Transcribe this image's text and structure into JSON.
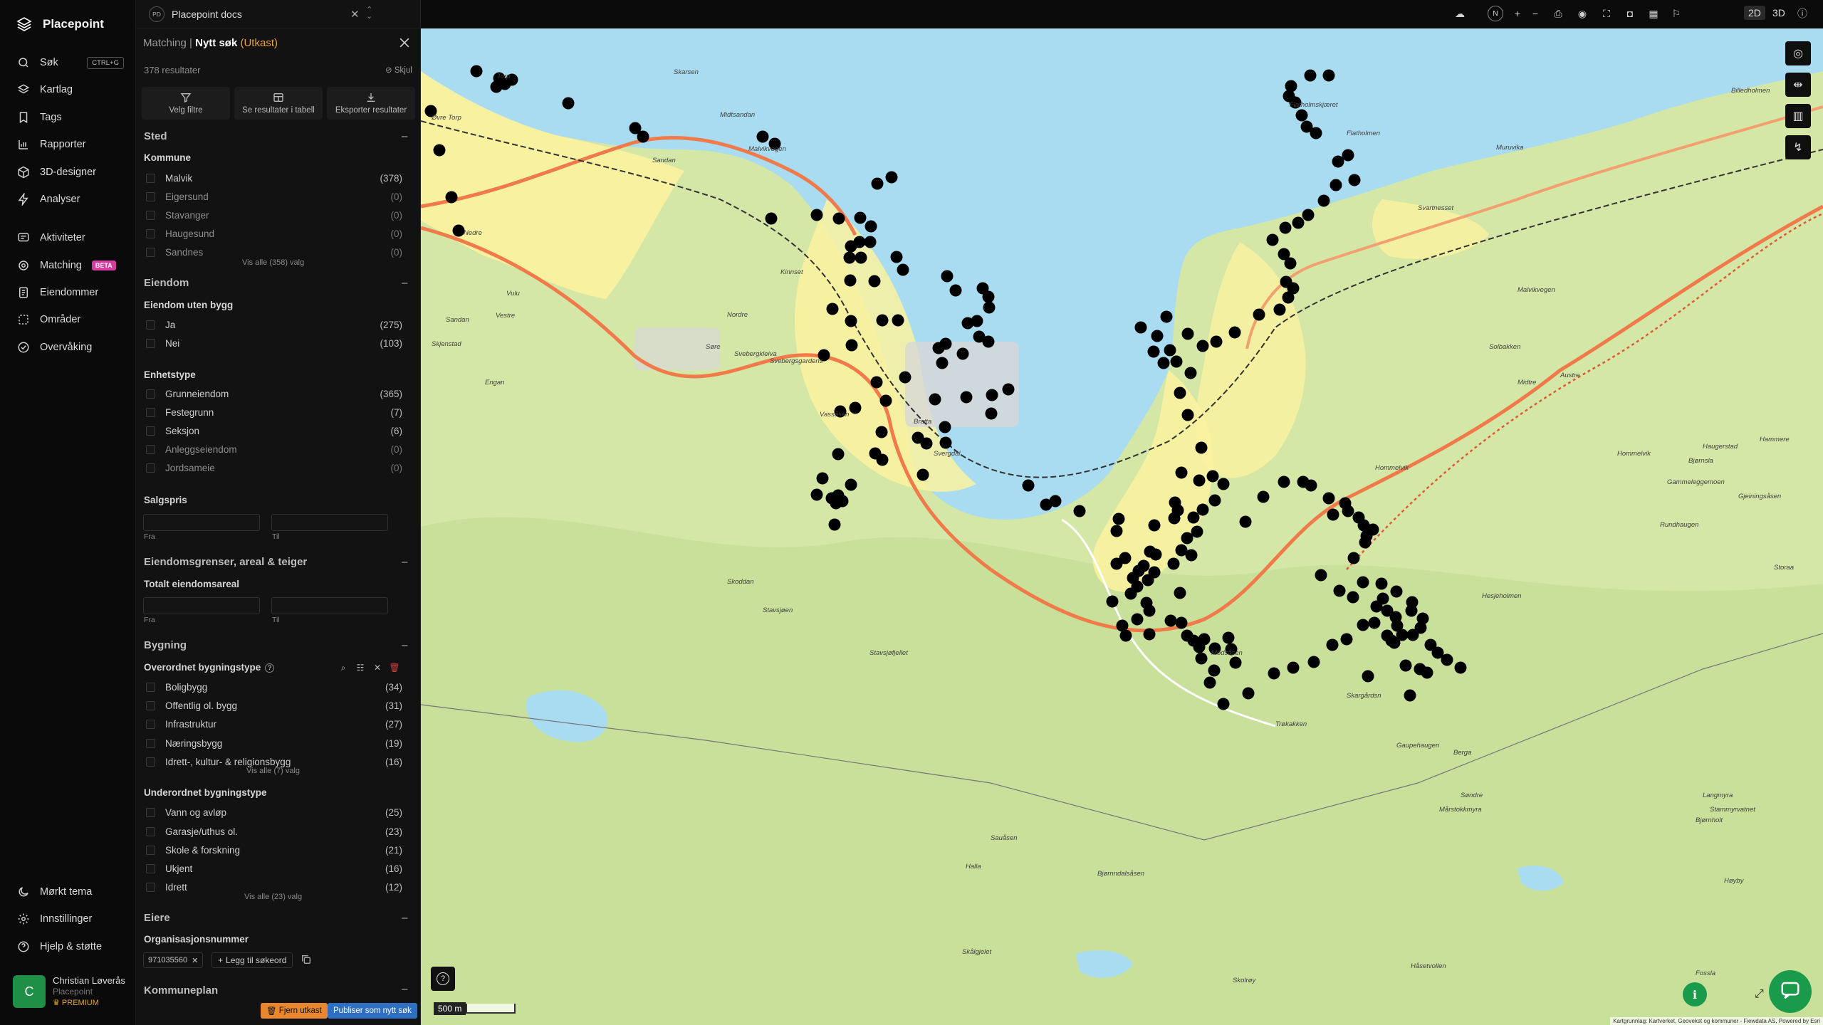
{
  "app": {
    "name": "Placepoint"
  },
  "nav": {
    "items": [
      {
        "label": "Søk",
        "shortcut": "CTRL+G"
      },
      {
        "label": "Kartlag"
      },
      {
        "label": "Tags"
      },
      {
        "label": "Rapporter"
      },
      {
        "label": "3D-designer"
      },
      {
        "label": "Analyser"
      },
      {
        "label": "Aktiviteter"
      },
      {
        "label": "Matching",
        "badge": "BETA"
      },
      {
        "label": "Eiendommer"
      },
      {
        "label": "Områder"
      },
      {
        "label": "Overvåking"
      }
    ],
    "bottom": [
      {
        "label": "Mørkt tema"
      },
      {
        "label": "Innstillinger"
      },
      {
        "label": "Hjelp & støtte"
      }
    ],
    "user": {
      "initial": "C",
      "name": "Christian Løverås",
      "org": "Placepoint",
      "tier": "PREMIUM"
    }
  },
  "panel": {
    "workspace": {
      "badge": "PD",
      "title": "Placepoint docs"
    },
    "breadcrumb": {
      "parent": "Matching",
      "sep": "|",
      "current": "Nytt søk",
      "status": "(Utkast)"
    },
    "result_count": "378 resultater",
    "hide_label": "Skjul",
    "actions": [
      {
        "label": "Velg filtre"
      },
      {
        "label": "Se resultater i tabell"
      },
      {
        "label": "Eksporter resultater"
      }
    ],
    "sted": {
      "title": "Sted",
      "kommune_title": "Kommune",
      "items": [
        {
          "label": "Malvik",
          "count": "(378)"
        },
        {
          "label": "Eigersund",
          "count": "(0)"
        },
        {
          "label": "Stavanger",
          "count": "(0)"
        },
        {
          "label": "Haugesund",
          "count": "(0)"
        },
        {
          "label": "Sandnes",
          "count": "(0)"
        }
      ],
      "view_all": "Vis alle (358) valg"
    },
    "eiendom": {
      "title": "Eiendom",
      "uten_bygg_title": "Eiendom uten bygg",
      "uten_bygg": [
        {
          "label": "Ja",
          "count": "(275)"
        },
        {
          "label": "Nei",
          "count": "(103)"
        }
      ],
      "enhetstype_title": "Enhetstype",
      "enhetstype": [
        {
          "label": "Grunneiendom",
          "count": "(365)"
        },
        {
          "label": "Festegrunn",
          "count": "(7)"
        },
        {
          "label": "Seksjon",
          "count": "(6)"
        },
        {
          "label": "Anleggseiendom",
          "count": "(0)"
        },
        {
          "label": "Jordsameie",
          "count": "(0)"
        }
      ],
      "salgspris_title": "Salgspris",
      "from": "Fra",
      "to": "Til"
    },
    "grenser": {
      "title": "Eiendomsgrenser, areal & teiger",
      "areal_title": "Totalt eiendomsareal",
      "from": "Fra",
      "to": "Til"
    },
    "bygning": {
      "title": "Bygning",
      "overordnet_title": "Overordnet bygningstype",
      "overordnet": [
        {
          "label": "Boligbygg",
          "count": "(34)"
        },
        {
          "label": "Offentlig ol. bygg",
          "count": "(31)"
        },
        {
          "label": "Infrastruktur",
          "count": "(27)"
        },
        {
          "label": "Næringsbygg",
          "count": "(19)"
        },
        {
          "label": "Idrett-, kultur- & religionsbygg",
          "count": "(16)"
        }
      ],
      "overordnet_view_all": "Vis alle (7) valg",
      "underordnet_title": "Underordnet bygningstype",
      "underordnet": [
        {
          "label": "Vann og avløp",
          "count": "(25)"
        },
        {
          "label": "Garasje/uthus ol.",
          "count": "(23)"
        },
        {
          "label": "Skole & forskning",
          "count": "(21)"
        },
        {
          "label": "Ukjent",
          "count": "(16)"
        },
        {
          "label": "Idrett",
          "count": "(12)"
        }
      ],
      "underordnet_view_all": "Vis alle (23) valg"
    },
    "eiere": {
      "title": "Eiere",
      "org_title": "Organisasjonsnummer",
      "org_value": "971035560",
      "add_keyword": "Legg til søkeord"
    },
    "kommuneplan": {
      "title": "Kommuneplan"
    },
    "footer": {
      "delete_draft": "Fjern utkast",
      "publish": "Publiser som nytt søk"
    }
  },
  "map": {
    "modes": [
      "2D",
      "3D"
    ],
    "active_mode": "2D",
    "compass": "N",
    "scale": "500 m",
    "attribution": "Kartgrunnlag: Kartverket, Geovekst og kommuner - Fiewdata AS, Powered by Esri",
    "colors": {
      "land": "#d4e7a6",
      "water": "#a9dcf0",
      "urban": "#fbf2a0",
      "forest": "#bfdc8d",
      "marker": "#000000",
      "road": "#f07a4a"
    },
    "places": [
      "Skarsen",
      "Malvikvegen",
      "Midtsandan",
      "Sandan",
      "Torp",
      "Øvre Torp",
      "Nedre",
      "Vulu",
      "Vestre",
      "Sandan",
      "Skjenstad",
      "Engan",
      "Kinnset",
      "Nordre",
      "Søre",
      "Svebergkleiva",
      "Svebergsgardens",
      "Vassåsen",
      "Bratta",
      "Svergdal",
      "Flatholmskjæret",
      "Flatholmen",
      "Muruvika",
      "Svartnesset",
      "Malvikvegen",
      "Hommelvik",
      "Solbakken",
      "Midtre",
      "Austre",
      "Hommelvik",
      "Haugerstad",
      "Bjørnsla",
      "Gjeiningsåsen",
      "Billedholmen",
      "Hammere",
      "Gammeleggemoen",
      "Rundhaugen",
      "Storaa",
      "Stavsjøfjellet",
      "Skoddan",
      "Stavsjøen",
      "Modsåsen",
      "Trøkakken",
      "Skargårdsn",
      "Gaupehaugen",
      "Berga",
      "Søndre",
      "Sauåsen",
      "Halla",
      "Hesjeholmen",
      "Langmyra",
      "Stammyrvatnet",
      "Fossla",
      "Bjørnndalsåsen",
      "Skålgjelet",
      "Skolrøy",
      "Bjørnholt",
      "Høyby",
      "Mårstokkmyra",
      "Håsetvollen"
    ]
  }
}
